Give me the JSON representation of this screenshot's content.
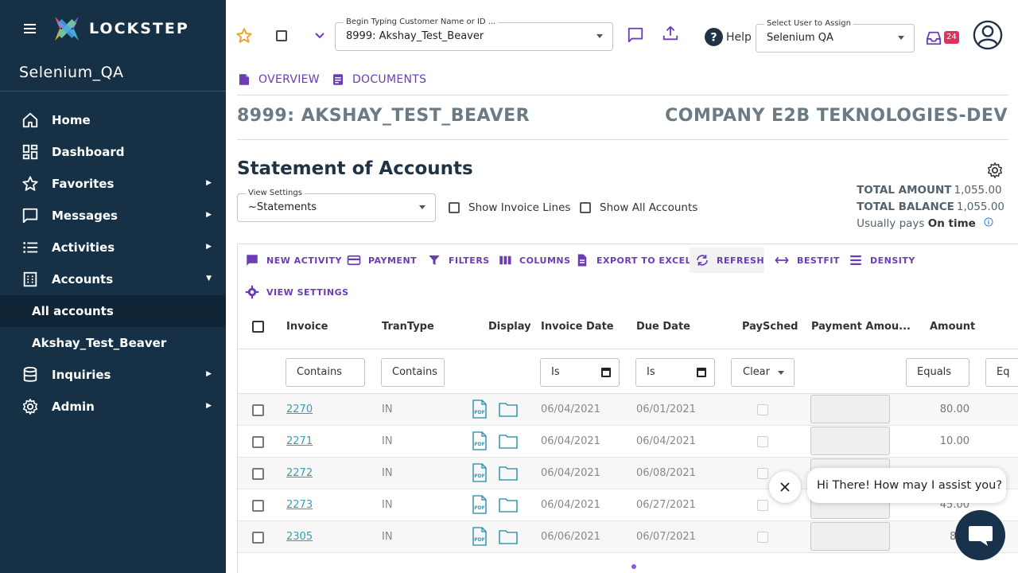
{
  "sidebar": {
    "brand": "LOCKSTEP",
    "org": "Selenium_QA",
    "items": [
      {
        "label": "Home"
      },
      {
        "label": "Dashboard"
      },
      {
        "label": "Favorites"
      },
      {
        "label": "Messages"
      },
      {
        "label": "Activities"
      },
      {
        "label": "Accounts"
      },
      {
        "label": "All accounts"
      },
      {
        "label": "Akshay_Test_Beaver"
      },
      {
        "label": "Inquiries"
      },
      {
        "label": "Admin"
      }
    ]
  },
  "header": {
    "customer_field_label": "Begin Typing Customer Name or ID ...",
    "customer_field_value": "8999: Akshay_Test_Beaver",
    "help_label": "Help",
    "assign_field_label": "Select User to Assign",
    "assign_field_value": "Selenium QA",
    "inbox_count": "24"
  },
  "tabs": [
    {
      "label": "OVERVIEW"
    },
    {
      "label": "DOCUMENTS"
    }
  ],
  "customer_title": "8999: AKSHAY_TEST_BEAVER",
  "company_title": "COMPANY E2B TEKNOLOGIES-DEV",
  "statement": {
    "title": "Statement of Accounts",
    "view_settings_label": "View Settings",
    "view_settings_value": "~Statements",
    "show_invoice_lines": "Show Invoice Lines",
    "show_all_accounts": "Show All Accounts",
    "total_amount_label": "TOTAL AMOUNT",
    "total_amount_value": "1,055.00",
    "total_balance_label": "TOTAL BALANCE",
    "total_balance_value": "1,055.00",
    "usually_pays_prefix": "Usually pays",
    "usually_pays_value": "On time"
  },
  "toolbar": {
    "new_activity": "NEW ACTIVITY",
    "payment": "PAYMENT",
    "filters": "FILTERS",
    "columns": "COLUMNS",
    "export": "EXPORT TO EXCEL",
    "refresh": "REFRESH",
    "bestfit": "BESTFIT",
    "density": "DENSITY",
    "view_settings": "VIEW SETTINGS"
  },
  "columns": [
    "Invoice",
    "TranType",
    "Display",
    "Invoice Date",
    "Due Date",
    "PaySched",
    "Payment Amou...",
    "Amount"
  ],
  "filters": {
    "invoice": "Contains",
    "trantype": "Contains",
    "invoice_date": "Is",
    "due_date": "Is",
    "paysched": "Clear",
    "amount": "Equals",
    "next": "Eq"
  },
  "rows": [
    {
      "invoice": "2270",
      "trantype": "IN",
      "invoice_date": "06/04/2021",
      "due_date": "06/01/2021",
      "amount": "80.00"
    },
    {
      "invoice": "2271",
      "trantype": "IN",
      "invoice_date": "06/04/2021",
      "due_date": "06/04/2021",
      "amount": "10.00"
    },
    {
      "invoice": "2272",
      "trantype": "IN",
      "invoice_date": "06/04/2021",
      "due_date": "06/08/2021",
      "amount": ""
    },
    {
      "invoice": "2273",
      "trantype": "IN",
      "invoice_date": "06/04/2021",
      "due_date": "06/27/2021",
      "amount": "45.00"
    },
    {
      "invoice": "2305",
      "trantype": "IN",
      "invoice_date": "06/06/2021",
      "due_date": "06/07/2021",
      "amount": "800"
    }
  ],
  "chat": {
    "greeting": "Hi There! How may I assist you?"
  },
  "colors": {
    "sidebar_bg": "#163145",
    "accent_purple": "#6a3db5",
    "link_teal": "#3e9ab0",
    "badge_red": "#e0325c"
  }
}
